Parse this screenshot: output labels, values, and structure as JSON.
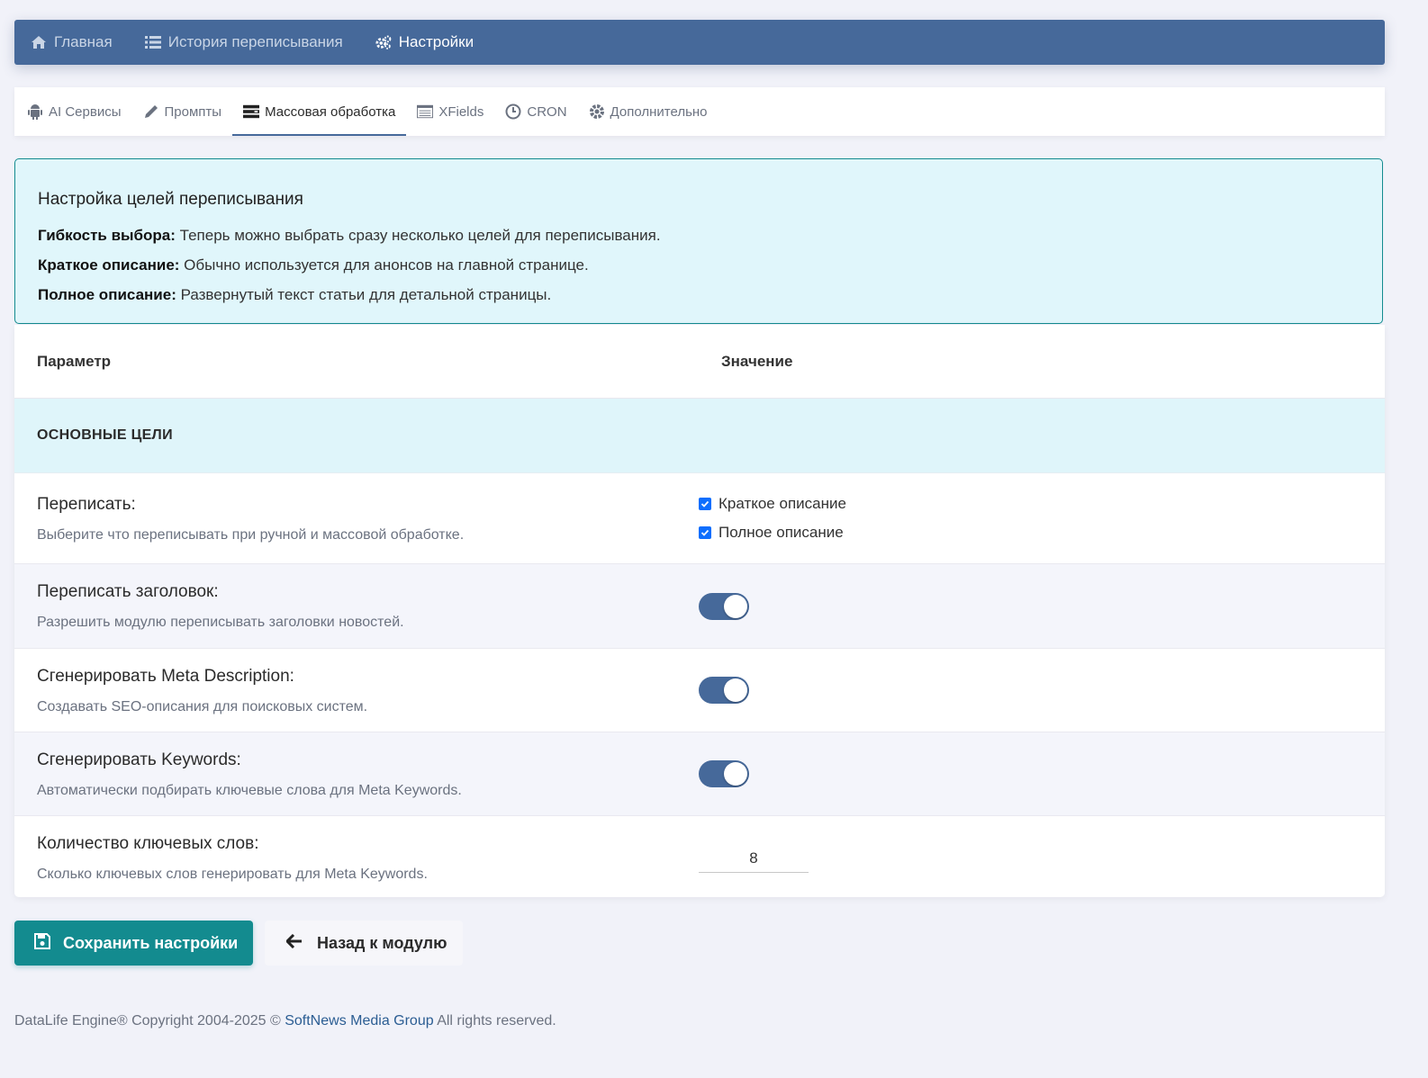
{
  "topnav": {
    "items": [
      {
        "label": "Главная",
        "icon": "home-icon"
      },
      {
        "label": "История переписывания",
        "icon": "list-icon"
      },
      {
        "label": "Настройки",
        "icon": "cogs-icon"
      }
    ]
  },
  "tabs": [
    {
      "label": "AI Сервисы",
      "icon": "android-icon"
    },
    {
      "label": "Промпты",
      "icon": "pencil-icon"
    },
    {
      "label": "Массовая обработка",
      "icon": "server-icon"
    },
    {
      "label": "XFields",
      "icon": "table-icon"
    },
    {
      "label": "CRON",
      "icon": "clock-icon"
    },
    {
      "label": "Дополнительно",
      "icon": "gear-icon"
    }
  ],
  "info": {
    "title": "Настройка целей переписывания",
    "lines": [
      {
        "bold": "Гибкость выбора:",
        "text": " Теперь можно выбрать сразу несколько целей для переписывания."
      },
      {
        "bold": "Краткое описание:",
        "text": " Обычно используется для анонсов на главной странице."
      },
      {
        "bold": "Полное описание:",
        "text": " Развернутый текст статьи для детальной страницы."
      }
    ]
  },
  "table": {
    "col_param": "Параметр",
    "col_value": "Значение",
    "section": "ОСНОВНЫЕ ЦЕЛИ",
    "rows": [
      {
        "title": "Переписать:",
        "desc": "Выберите что переписывать при ручной и массовой обработке.",
        "options": [
          {
            "label": "Краткое описание",
            "checked": true
          },
          {
            "label": "Полное описание",
            "checked": true
          }
        ]
      },
      {
        "title": "Переписать заголовок:",
        "desc": "Разрешить модулю переписывать заголовки новостей.",
        "toggle": true
      },
      {
        "title": "Сгенерировать Meta Description:",
        "desc": "Создавать SEO-описания для поисковых систем.",
        "toggle": true
      },
      {
        "title": "Сгенерировать Keywords:",
        "desc": "Автоматически подбирать ключевые слова для Meta Keywords.",
        "toggle": true
      },
      {
        "title": "Количество ключевых слов:",
        "desc": "Сколько ключевых слов генерировать для Meta Keywords.",
        "value": "8"
      }
    ]
  },
  "buttons": {
    "save": "Сохранить настройки",
    "back": "Назад к модулю"
  },
  "footer": {
    "prefix": "DataLife Engine® Copyright 2004-2025 ©",
    "link": "SoftNews Media Group",
    "suffix": "All rights reserved."
  },
  "colors": {
    "nav": "#46699a",
    "accent": "#138b8f",
    "info_bg": "#e0f6fb"
  }
}
